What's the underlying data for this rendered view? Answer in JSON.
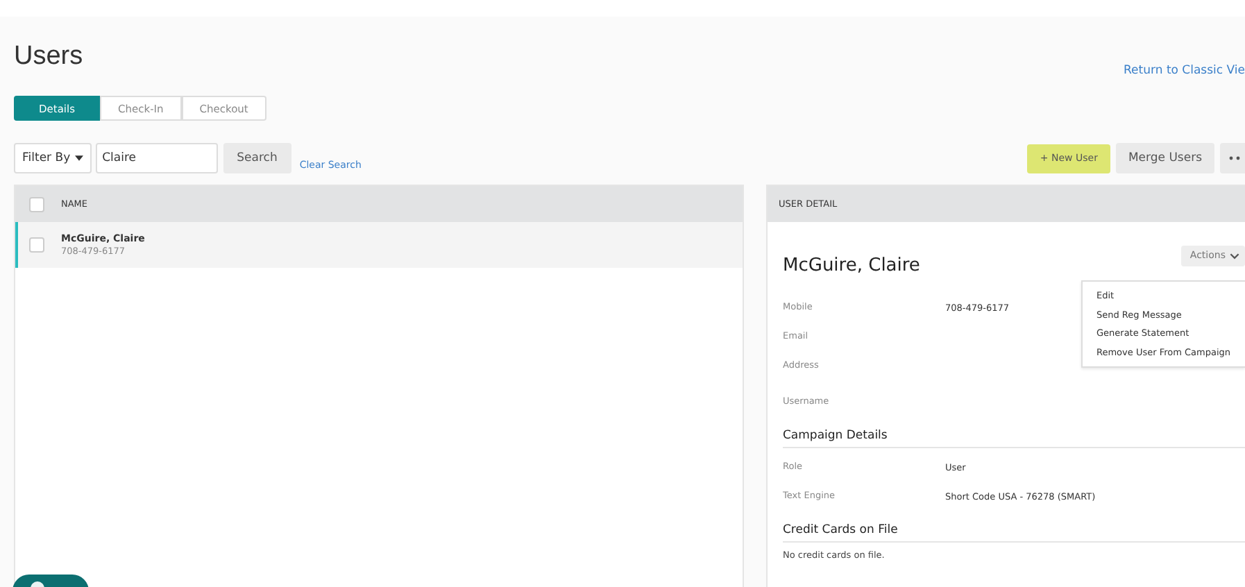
{
  "page": {
    "title": "Users",
    "return_link": "Return to Classic Vie"
  },
  "tabs": [
    {
      "label": "Details",
      "selected": true
    },
    {
      "label": "Check-In",
      "selected": false
    },
    {
      "label": "Checkout",
      "selected": false
    }
  ],
  "filter": {
    "dropdown": "Filter By",
    "search_value": "Claire",
    "search_button": "Search",
    "clear_link": "Clear Search"
  },
  "actions": {
    "new_user": "+ New User",
    "merge": "Merge Users"
  },
  "user_list": {
    "column": "NAME",
    "all_checked": false,
    "rows": [
      {
        "name": "McGuire, Claire",
        "phone": "708-479-6177",
        "selected": true,
        "checked": false
      }
    ]
  },
  "user_detail": {
    "header": "USER DETAIL",
    "name": "McGuire, Claire",
    "actions_button": "Actions",
    "actions_menu": [
      "Edit",
      "Send Reg Message",
      "Generate Statement",
      "Remove User From Campaign"
    ],
    "fields": [
      {
        "label": "Mobile",
        "value": "708-479-6177"
      },
      {
        "label": "Email"
      },
      {
        "label": "Address"
      },
      {
        "label": "Username"
      }
    ],
    "sections": [
      {
        "title": "Campaign Details",
        "fields": [
          {
            "label": "Role",
            "value": "User"
          },
          {
            "label": "Text Engine",
            "value": "Short Code USA - 76278 (SMART)"
          }
        ]
      },
      {
        "title": "Credit Cards on File",
        "note": "No credit cards on file."
      }
    ]
  }
}
